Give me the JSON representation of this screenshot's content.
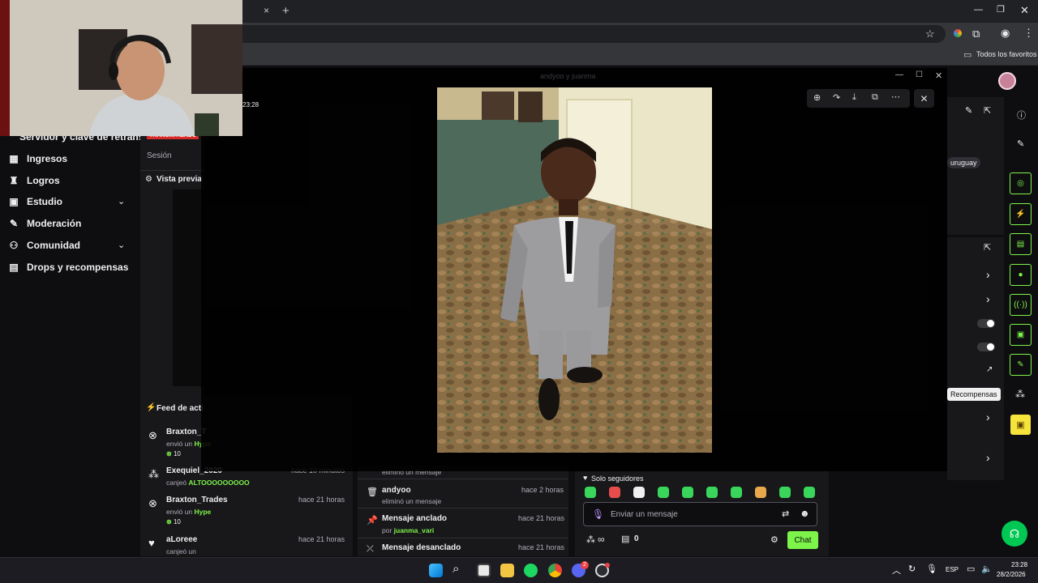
{
  "browser": {
    "new_tab": "+",
    "close_tab": "×",
    "bookmarks_folder": "Todos los favoritos"
  },
  "webcam": {
    "time": "23:28"
  },
  "sidebar": {
    "heading": "Servidor y clave de retransm",
    "items": [
      {
        "label": "Ingresos",
        "icon": "bank-icon"
      },
      {
        "label": "Logros",
        "icon": "trophy-icon"
      },
      {
        "label": "Estudio",
        "icon": "camera-icon"
      },
      {
        "label": "Moderación",
        "icon": "wrench-icon"
      },
      {
        "label": "Comunidad",
        "icon": "people-icon"
      },
      {
        "label": "Drops y recompensas",
        "icon": "gift-icon"
      }
    ]
  },
  "preview": {
    "badge": "TRANSMITIENDO",
    "session_label": "Sesión",
    "title": "Vista previa"
  },
  "activity_feed": {
    "title": "Feed de acti",
    "rows": [
      {
        "name": "Braxton_T",
        "time": "",
        "line1_prefix": "envió un ",
        "line1_highlight": "Hype",
        "amount": "10"
      },
      {
        "name": "Exequiel_2020",
        "time": "hace 10 minutos",
        "line1_prefix": "canjeó ",
        "line1_highlight": "ALTOOOOOOOOO",
        "amount": ""
      },
      {
        "name": "Braxton_Trades",
        "time": "hace 21 horas",
        "line1_prefix": "envió un ",
        "line1_highlight": "Hype",
        "amount": "10"
      },
      {
        "name": "aLoreee",
        "time": "hace 21 horas",
        "line1_prefix": "canjeó un ",
        "line1_highlight": "",
        "amount": ""
      }
    ]
  },
  "mod_actions": {
    "rows": [
      {
        "title": "",
        "time": "",
        "sub": "eliminó un mensaje",
        "by": ""
      },
      {
        "title": "andyoo",
        "time": "hace 2 horas",
        "sub": "eliminó un mensaje",
        "by": ""
      },
      {
        "title": "Mensaje anclado",
        "time": "hace 21 horas",
        "sub": "por ",
        "by": "juanma_vari"
      },
      {
        "title": "Mensaje desanclado",
        "time": "hace 21 horas",
        "sub": "",
        "by": ""
      }
    ]
  },
  "chat": {
    "mode": "Solo seguidores",
    "placeholder": "Enviar un mensaje",
    "points": "0",
    "chat_button": "Chat",
    "infinity": "∞"
  },
  "right_rail": {
    "tag": "uruguay",
    "tooltip": "Recompensas"
  },
  "overlay": {
    "title": "andyoo y juanma",
    "tools": [
      "zoom-in-icon",
      "rotate-icon",
      "download-icon",
      "open-external-icon",
      "more-icon"
    ]
  },
  "taskbar": {
    "lang": "ESP",
    "time": "23:28",
    "date": "28/2/2026",
    "discord_badge": "2"
  },
  "colors": {
    "twitch_green": "#7df44a",
    "panel": "#18181b",
    "background": "#0e0e10",
    "discord_red": "#ed4245"
  }
}
